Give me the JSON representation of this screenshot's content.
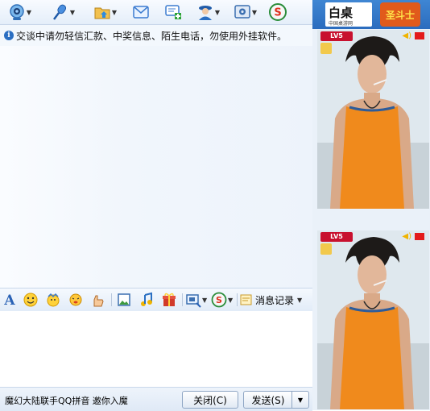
{
  "notice": {
    "text": "交谈中请勿轻信汇款、中奖信息、陌生电话，勿使用外挂软件。"
  },
  "format_bar": {
    "message_record_label": "消息记录"
  },
  "bottom": {
    "ad_text": "魔幻大陆联手QQ拼音 邀你入魔",
    "close_label": "关闭(C)",
    "send_label": "发送(S)"
  },
  "right_panel": {
    "banner_logo_text": "白桌",
    "banner_logo_subtext": "中国桌游网",
    "banner_game_logo": "圣斗士",
    "badge_label": "LV5"
  },
  "colors": {
    "toolbar_bg": "#e4eef9",
    "chat_bg": "#f2f7fc",
    "accent_blue": "#2b6cbe",
    "badge_red": "#c8102e"
  },
  "icons": {
    "toolbar": [
      "video-call-icon",
      "voice-call-icon",
      "send-file-icon",
      "send-sms-icon",
      "create-group-icon",
      "remote-assist-icon",
      "settings-icon",
      "soso-icon"
    ],
    "format": [
      "font-icon",
      "emoticon-icon",
      "magic-emoticon-icon",
      "shake-window-icon",
      "hand-gesture-icon",
      "image-icon",
      "music-icon",
      "gift-icon",
      "screenshot-icon",
      "soso-search-icon"
    ]
  }
}
